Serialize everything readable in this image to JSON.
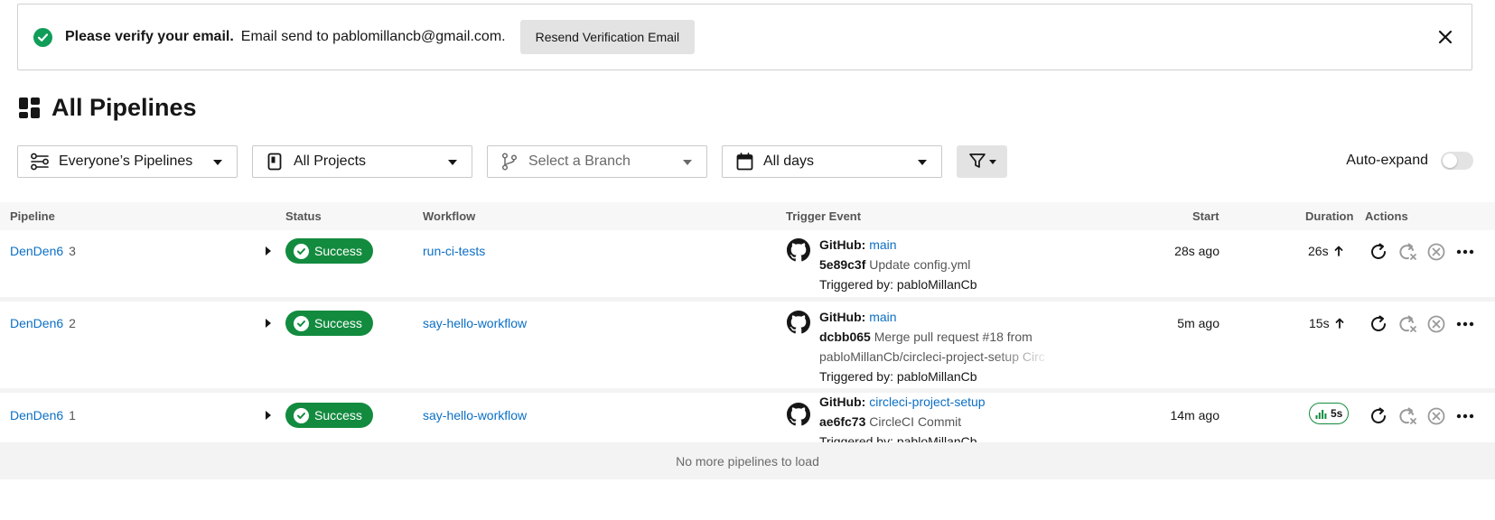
{
  "banner": {
    "strong_text": "Please verify your email.",
    "message": "Email send to pablomillancb@gmail.com.",
    "resend_label": "Resend Verification Email",
    "check_icon": "check-circle-icon",
    "close_icon": "close-icon"
  },
  "page": {
    "title": "All Pipelines",
    "title_icon": "dashboard-icon"
  },
  "filters": {
    "pipelines": {
      "label": "Everyone’s Pipelines",
      "icon": "people-icon"
    },
    "projects": {
      "label": "All Projects",
      "icon": "project-icon"
    },
    "branch": {
      "placeholder": "Select a Branch",
      "icon": "branch-icon"
    },
    "days": {
      "label": "All days",
      "icon": "calendar-icon"
    },
    "filter_icon": "filter-icon",
    "auto_expand_label": "Auto-expand",
    "auto_expand_on": false
  },
  "table": {
    "headers": {
      "pipeline": "Pipeline",
      "status": "Status",
      "workflow": "Workflow",
      "trigger": "Trigger Event",
      "start": "Start",
      "duration": "Duration",
      "actions": "Actions"
    },
    "rows": [
      {
        "project": "DenDen6",
        "number": "3",
        "status": "Success",
        "workflow": "run-ci-tests",
        "trigger_source": "GitHub:",
        "branch": "main",
        "sha": "5e89c3f",
        "commit_line1": "Update config.yml",
        "commit_line2": "",
        "triggered_by": "Triggered by: pabloMillanCb",
        "start": "28s ago",
        "duration": "26s"
      },
      {
        "project": "DenDen6",
        "number": "2",
        "status": "Success",
        "workflow": "say-hello-workflow",
        "trigger_source": "GitHub:",
        "branch": "main",
        "sha": "dcbb065",
        "commit_line1": "Merge pull request #18 from",
        "commit_line2": "pabloMillanCb/circleci-project-setup Circ",
        "triggered_by": "Triggered by: pabloMillanCb",
        "start": "5m ago",
        "duration": "15s"
      },
      {
        "project": "DenDen6",
        "number": "1",
        "status": "Success",
        "workflow": "say-hello-workflow",
        "trigger_source": "GitHub:",
        "branch": "circleci-project-setup",
        "sha": "ae6fc73",
        "commit_line1": "CircleCI Commit",
        "commit_line2": "",
        "triggered_by": "Triggered by: pabloMillanCb",
        "start": "14m ago",
        "duration": "5s"
      }
    ],
    "footer": "No more pipelines to load"
  },
  "colors": {
    "success": "#138b3f",
    "link": "#0b6fc5",
    "banner_check": "#0f9d58"
  }
}
